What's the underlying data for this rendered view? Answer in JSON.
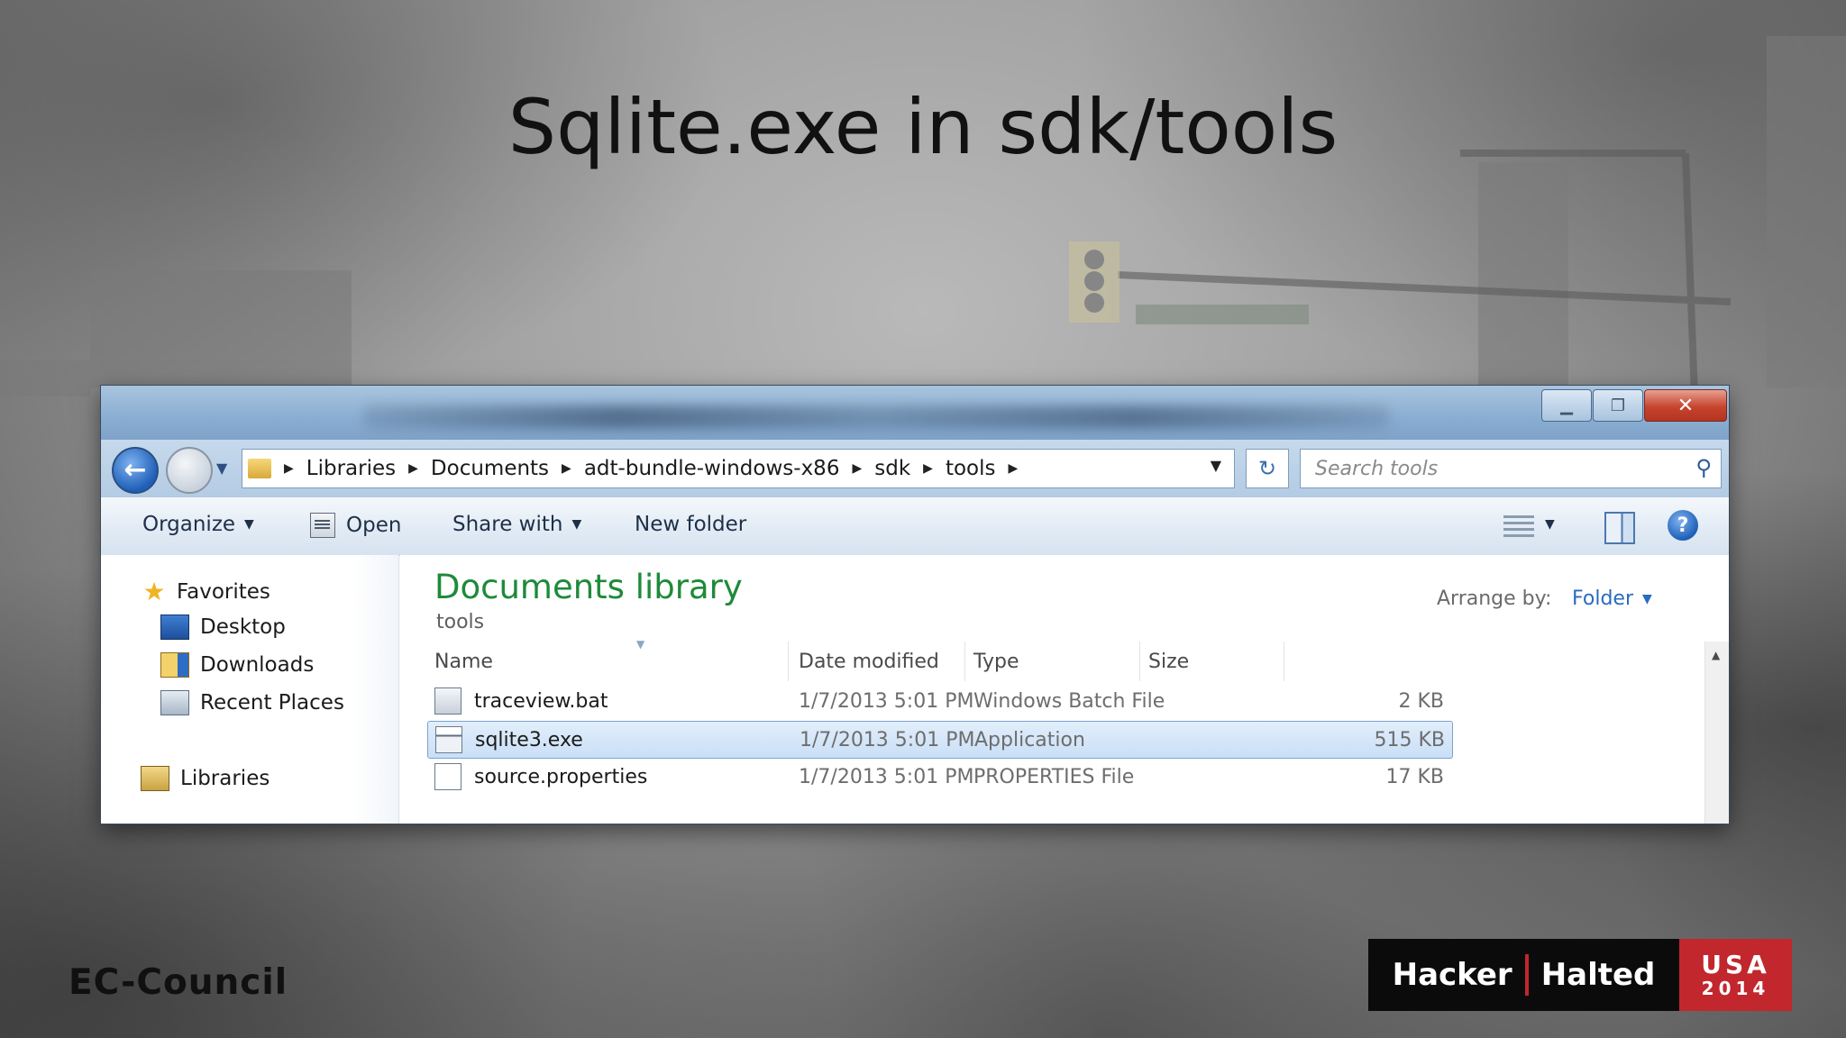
{
  "slide": {
    "title": "Sqlite.exe in sdk/tools"
  },
  "explorer": {
    "breadcrumb": [
      "Libraries",
      "Documents",
      "adt-bundle-windows-x86",
      "sdk",
      "tools"
    ],
    "search_placeholder": "Search tools",
    "toolbar": {
      "organize": "Organize",
      "open": "Open",
      "share_with": "Share with",
      "new_folder": "New folder"
    },
    "nav": {
      "favorites": "Favorites",
      "desktop": "Desktop",
      "downloads": "Downloads",
      "recent_places": "Recent Places",
      "libraries": "Libraries"
    },
    "library": {
      "title": "Documents library",
      "subtitle": "tools",
      "arrange_by_label": "Arrange by:",
      "arrange_by_value": "Folder"
    },
    "columns": {
      "name": "Name",
      "date_modified": "Date modified",
      "type": "Type",
      "size": "Size"
    },
    "files": [
      {
        "name": "traceview.bat",
        "date": "1/7/2013 5:01 PM",
        "type": "Windows Batch File",
        "size": "2 KB",
        "icon": "batch-file-icon",
        "selected": false
      },
      {
        "name": "sqlite3.exe",
        "date": "1/7/2013 5:01 PM",
        "type": "Application",
        "size": "515 KB",
        "icon": "application-icon",
        "selected": true
      },
      {
        "name": "source.properties",
        "date": "1/7/2013 5:01 PM",
        "type": "PROPERTIES File",
        "size": "17 KB",
        "icon": "document-icon",
        "selected": false
      }
    ]
  },
  "branding": {
    "left_logo": "EC-Council",
    "hh_word1": "Hacker",
    "hh_word2": "Halted",
    "hh_country": "USA",
    "hh_year": "2014"
  },
  "colors": {
    "library_title": "#1e8a3a",
    "selection": "#c9dff7",
    "brand_red": "#c1272d"
  }
}
